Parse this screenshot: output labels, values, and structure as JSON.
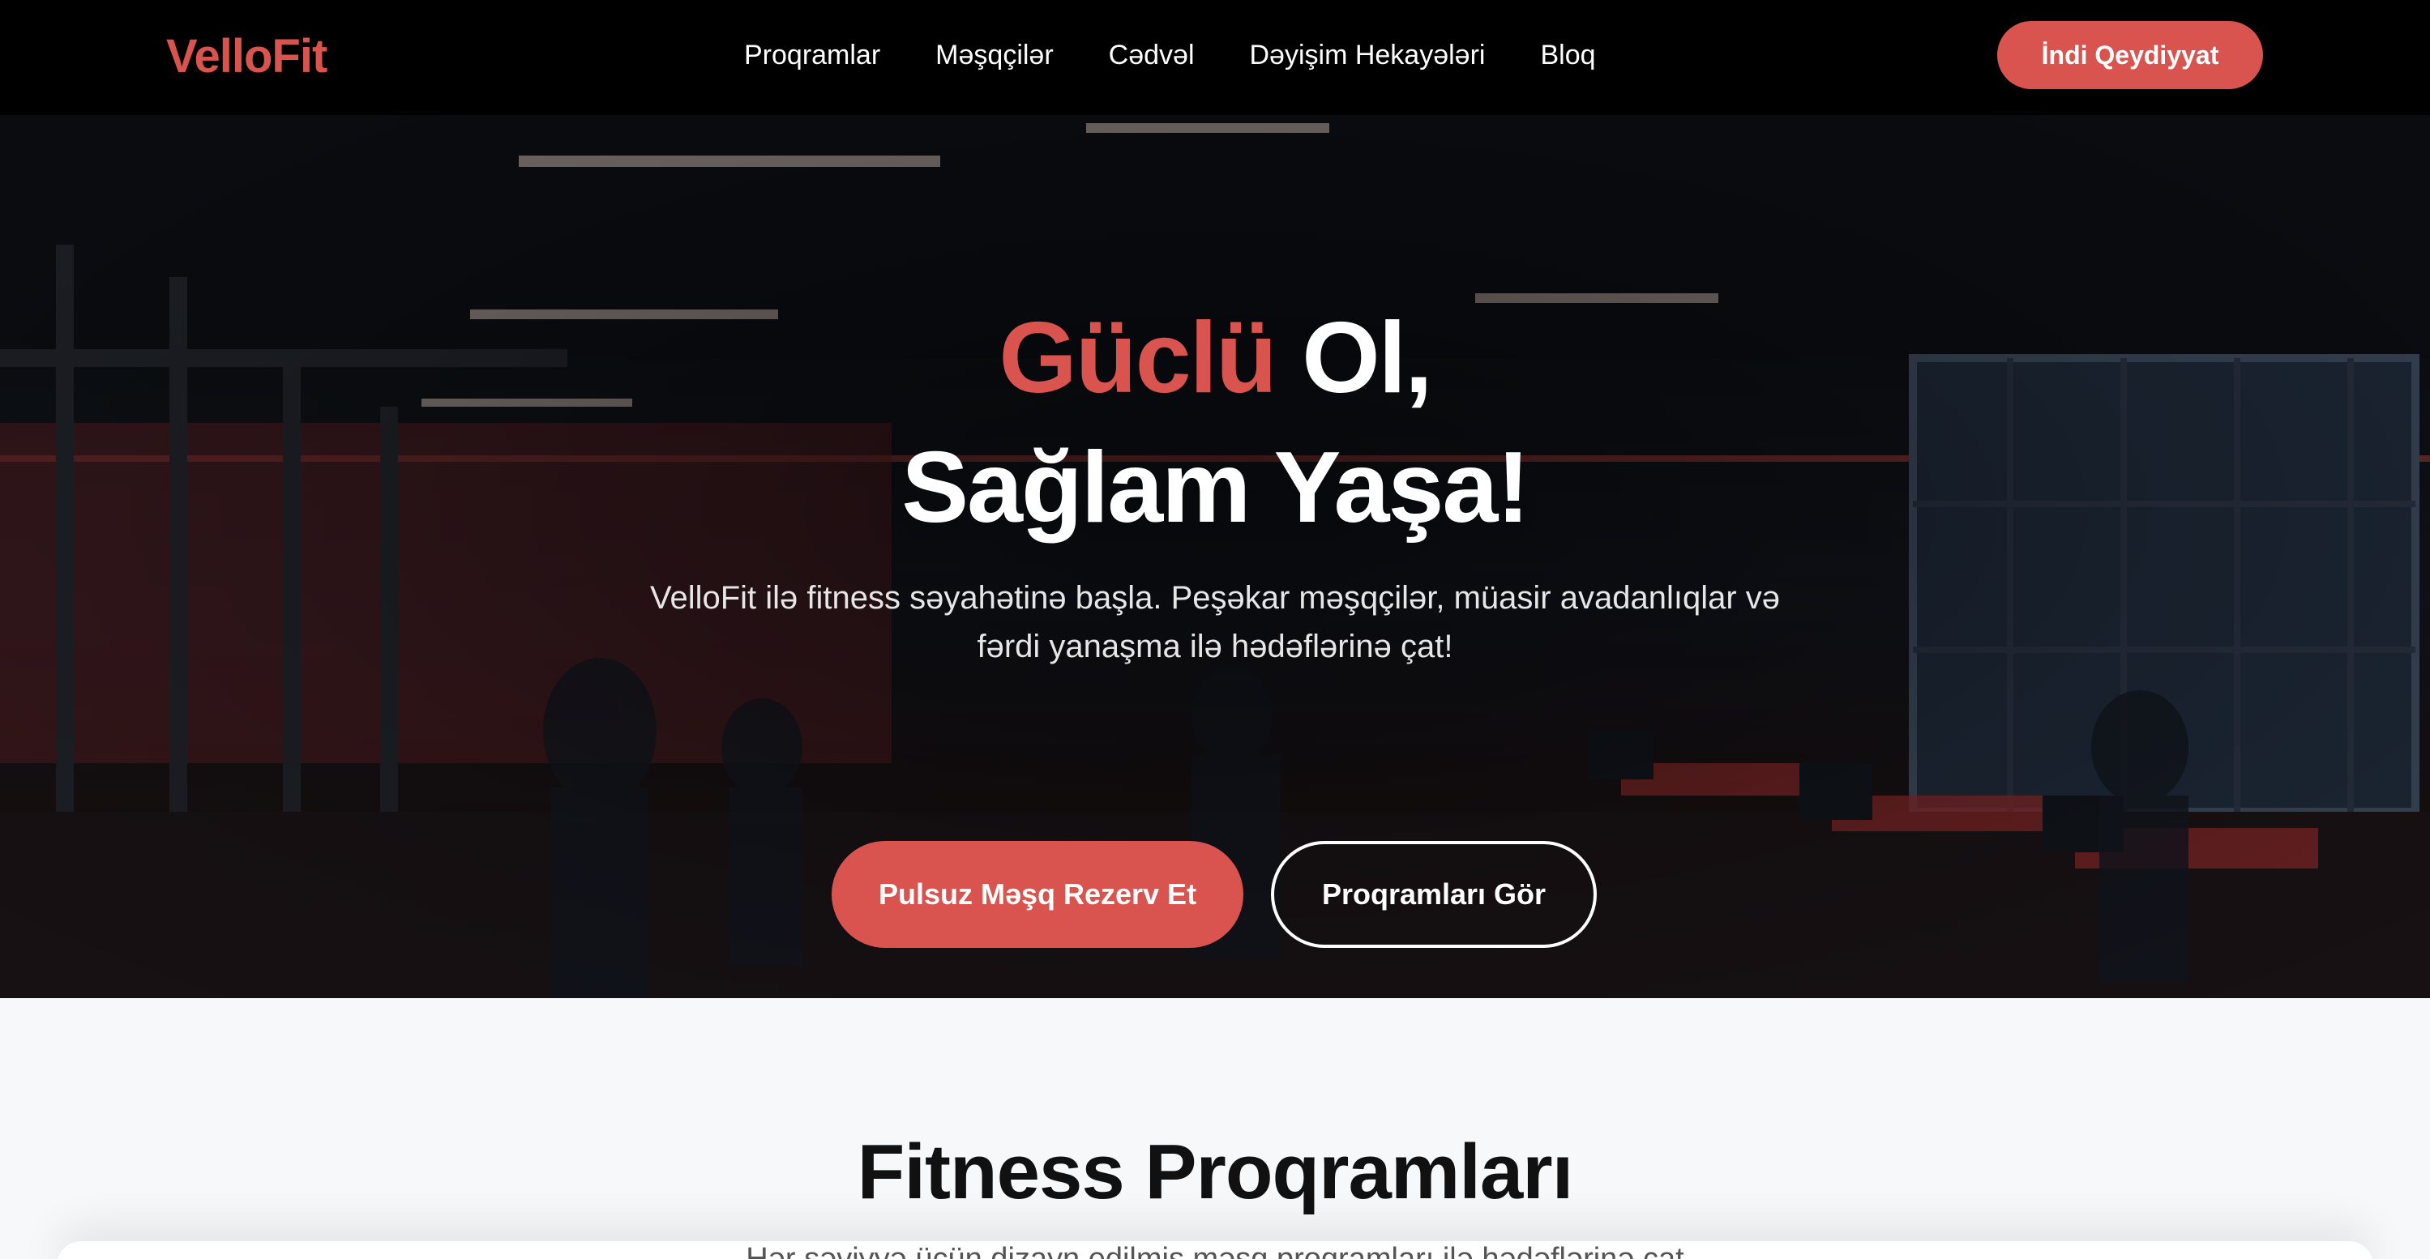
{
  "brand": {
    "name": "VelloFit",
    "accent_color": "#d9534f"
  },
  "nav": {
    "links": [
      "Proqramlar",
      "Məşqçilər",
      "Cədvəl",
      "Dəyişim Hekayələri",
      "Bloq"
    ],
    "cta_label": "İndi Qeydiyyat"
  },
  "hero": {
    "title_accent": "Güclü",
    "title_rest_line1": " Ol,",
    "title_line2": "Sağlam Yaşa!",
    "subtitle": "VelloFit ilə fitness səyahətinə başla. Peşəkar məşqçilər, müasir avadanlıqlar və fərdi yanaşma ilə hədəflərinə çat!",
    "primary_button": "Pulsuz Məşq Rezerv Et",
    "secondary_button": "Proqramları Gör",
    "background_image": "gym-interior"
  },
  "programs": {
    "title": "Fitness Proqramları",
    "subtitle": "Hər səviyyə üçün dizayn edilmiş məşq proqramları ilə hədəflərinə çat"
  }
}
